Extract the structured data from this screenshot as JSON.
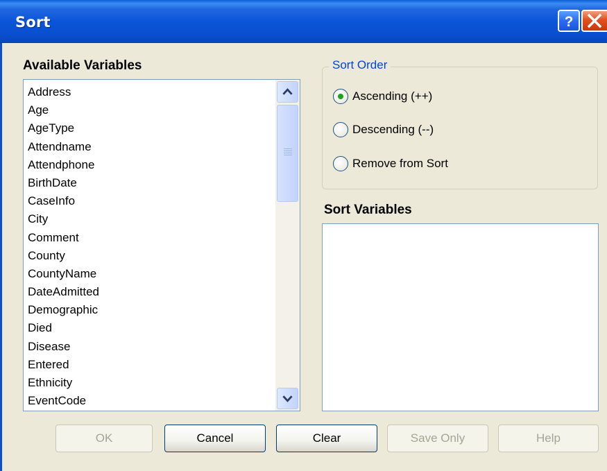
{
  "window": {
    "title": "Sort"
  },
  "left": {
    "label": "Available Variables",
    "items": [
      "Address",
      "Age",
      "AgeType",
      "Attendname",
      "Attendphone",
      "BirthDate",
      "CaseInfo",
      "City",
      "Comment",
      "County",
      "CountyName",
      "DateAdmitted",
      "Demographic",
      "Died",
      "Disease",
      "Entered",
      "Ethnicity",
      "EventCode"
    ]
  },
  "sort_order": {
    "label": "Sort Order",
    "options": [
      {
        "label": "Ascending (++)",
        "selected": true
      },
      {
        "label": "Descending (--)",
        "selected": false
      },
      {
        "label": "Remove from Sort",
        "selected": false
      }
    ]
  },
  "sort_variables": {
    "label": "Sort Variables",
    "items": []
  },
  "buttons": {
    "ok": {
      "label": "OK",
      "enabled": false
    },
    "cancel": {
      "label": "Cancel",
      "enabled": true
    },
    "clear": {
      "label": "Clear",
      "enabled": true
    },
    "save_only": {
      "label": "Save Only",
      "enabled": false
    },
    "help": {
      "label": "Help",
      "enabled": false
    }
  },
  "colors": {
    "title_bar": "#0a4fd0",
    "dialog_bg": "#ece9d8",
    "group_label": "#0046d5",
    "radio_dot": "#21a121"
  }
}
